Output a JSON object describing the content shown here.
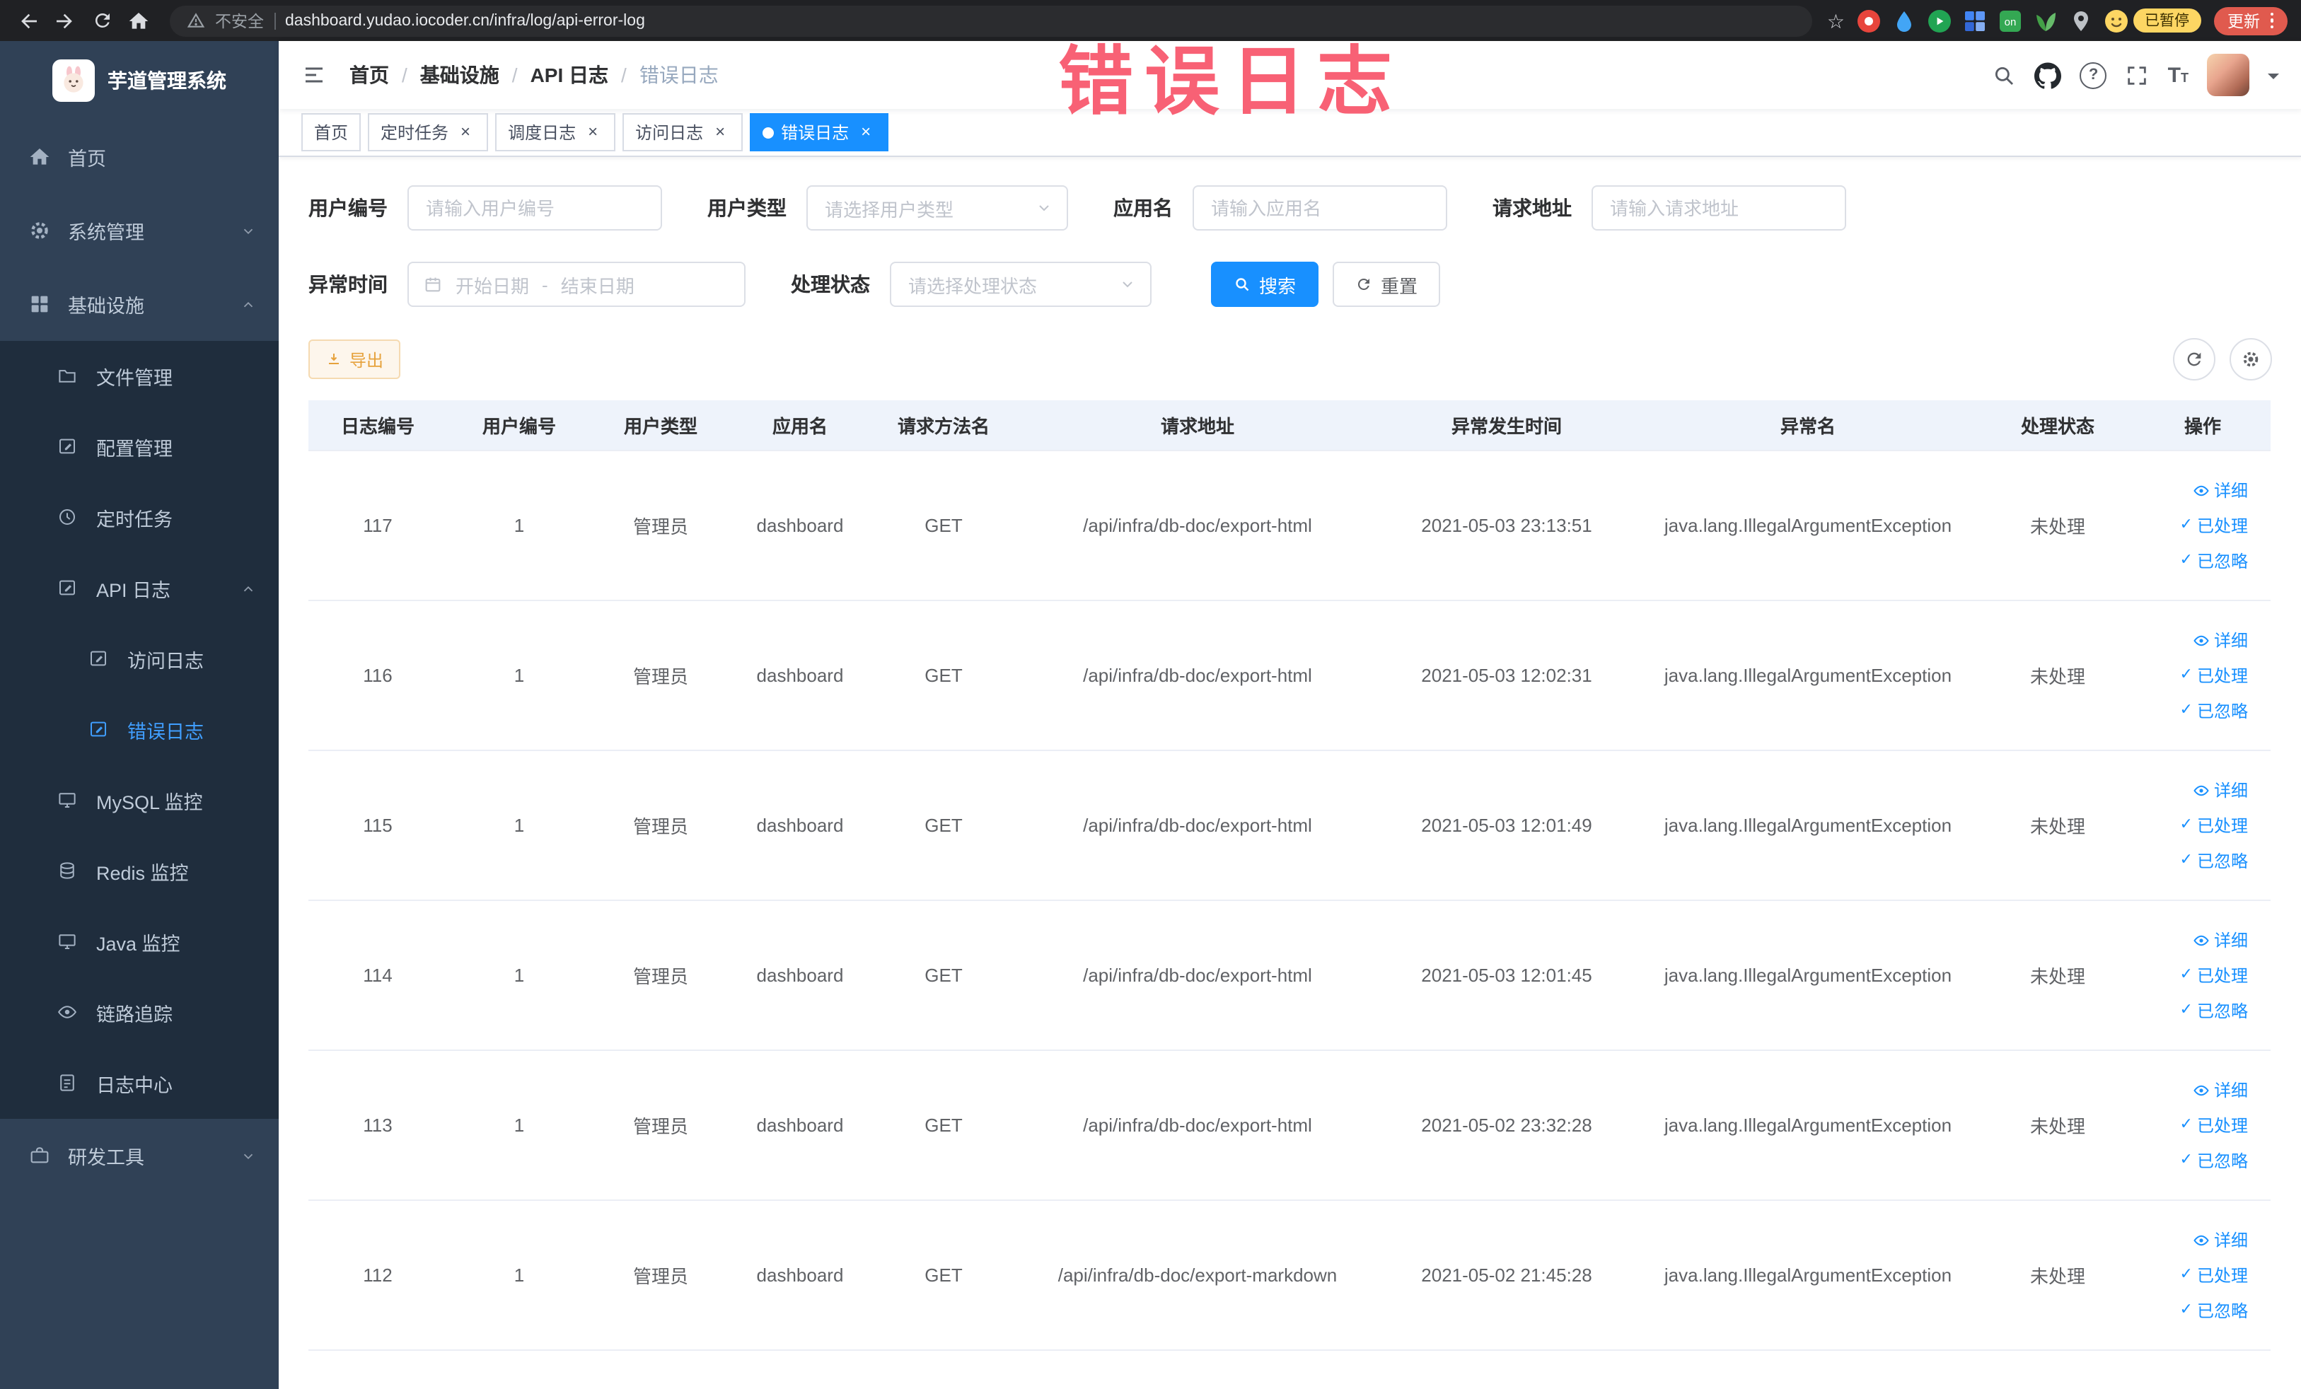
{
  "browser": {
    "security_label": "不安全",
    "url": "dashboard.yudao.iocoder.cn/infra/log/api-error-log",
    "extensions": {
      "on_badge": "on",
      "paused_badge": "已暂停",
      "update_button": "更新"
    }
  },
  "overlay_annotation": "错误日志",
  "sidebar": {
    "logo_title": "芋道管理系统",
    "items": [
      {
        "label": "首页"
      },
      {
        "label": "系统管理"
      },
      {
        "label": "基础设施"
      },
      {
        "label": "文件管理"
      },
      {
        "label": "配置管理"
      },
      {
        "label": "定时任务"
      },
      {
        "label": "API 日志"
      },
      {
        "label": "访问日志"
      },
      {
        "label": "错误日志"
      },
      {
        "label": "MySQL 监控"
      },
      {
        "label": "Redis 监控"
      },
      {
        "label": "Java 监控"
      },
      {
        "label": "链路追踪"
      },
      {
        "label": "日志中心"
      },
      {
        "label": "研发工具"
      }
    ]
  },
  "header": {
    "breadcrumb": [
      {
        "label": "首页"
      },
      {
        "label": "基础设施"
      },
      {
        "label": "API 日志"
      },
      {
        "label": "错误日志"
      }
    ]
  },
  "tabs": [
    {
      "label": "首页"
    },
    {
      "label": "定时任务"
    },
    {
      "label": "调度日志"
    },
    {
      "label": "访问日志"
    },
    {
      "label": "错误日志"
    }
  ],
  "filters": {
    "user_id_label": "用户编号",
    "user_id_placeholder": "请输入用户编号",
    "user_type_label": "用户类型",
    "user_type_placeholder": "请选择用户类型",
    "app_name_label": "应用名",
    "app_name_placeholder": "请输入应用名",
    "request_url_label": "请求地址",
    "request_url_placeholder": "请输入请求地址",
    "time_label": "异常时间",
    "time_start_placeholder": "开始日期",
    "time_separator": "-",
    "time_end_placeholder": "结束日期",
    "status_label": "处理状态",
    "status_placeholder": "请选择处理状态",
    "search_button": "搜索",
    "reset_button": "重置"
  },
  "toolbar": {
    "export_button": "导出"
  },
  "table": {
    "columns": [
      "日志编号",
      "用户编号",
      "用户类型",
      "应用名",
      "请求方法名",
      "请求地址",
      "异常发生时间",
      "异常名",
      "处理状态",
      "操作"
    ],
    "actions": {
      "detail": "详细",
      "processed": "已处理",
      "ignored": "已忽略"
    },
    "rows": [
      {
        "log_id": "117",
        "user_id": "1",
        "user_type": "管理员",
        "app_name": "dashboard",
        "method": "GET",
        "url": "/api/infra/db-doc/export-html",
        "time": "2021-05-03 23:13:51",
        "exception": "java.lang.IllegalArgumentException",
        "status": "未处理"
      },
      {
        "log_id": "116",
        "user_id": "1",
        "user_type": "管理员",
        "app_name": "dashboard",
        "method": "GET",
        "url": "/api/infra/db-doc/export-html",
        "time": "2021-05-03 12:02:31",
        "exception": "java.lang.IllegalArgumentException",
        "status": "未处理"
      },
      {
        "log_id": "115",
        "user_id": "1",
        "user_type": "管理员",
        "app_name": "dashboard",
        "method": "GET",
        "url": "/api/infra/db-doc/export-html",
        "time": "2021-05-03 12:01:49",
        "exception": "java.lang.IllegalArgumentException",
        "status": "未处理"
      },
      {
        "log_id": "114",
        "user_id": "1",
        "user_type": "管理员",
        "app_name": "dashboard",
        "method": "GET",
        "url": "/api/infra/db-doc/export-html",
        "time": "2021-05-03 12:01:45",
        "exception": "java.lang.IllegalArgumentException",
        "status": "未处理"
      },
      {
        "log_id": "113",
        "user_id": "1",
        "user_type": "管理员",
        "app_name": "dashboard",
        "method": "GET",
        "url": "/api/infra/db-doc/export-html",
        "time": "2021-05-02 23:32:28",
        "exception": "java.lang.IllegalArgumentException",
        "status": "未处理"
      },
      {
        "log_id": "112",
        "user_id": "1",
        "user_type": "管理员",
        "app_name": "dashboard",
        "method": "GET",
        "url": "/api/infra/db-doc/export-markdown",
        "time": "2021-05-02 21:45:28",
        "exception": "java.lang.IllegalArgumentException",
        "status": "未处理"
      }
    ]
  },
  "icons": {
    "close": "×",
    "check": "✓",
    "star": "☆",
    "size_T": "T",
    "help": "?"
  },
  "colors": {
    "accent_blue": "#1890ff",
    "active_menu_text": "#409eff",
    "export_warning": "#e6a23c",
    "active_tab_bg": "#1890ff",
    "annotation_pink": "#f8566b"
  }
}
